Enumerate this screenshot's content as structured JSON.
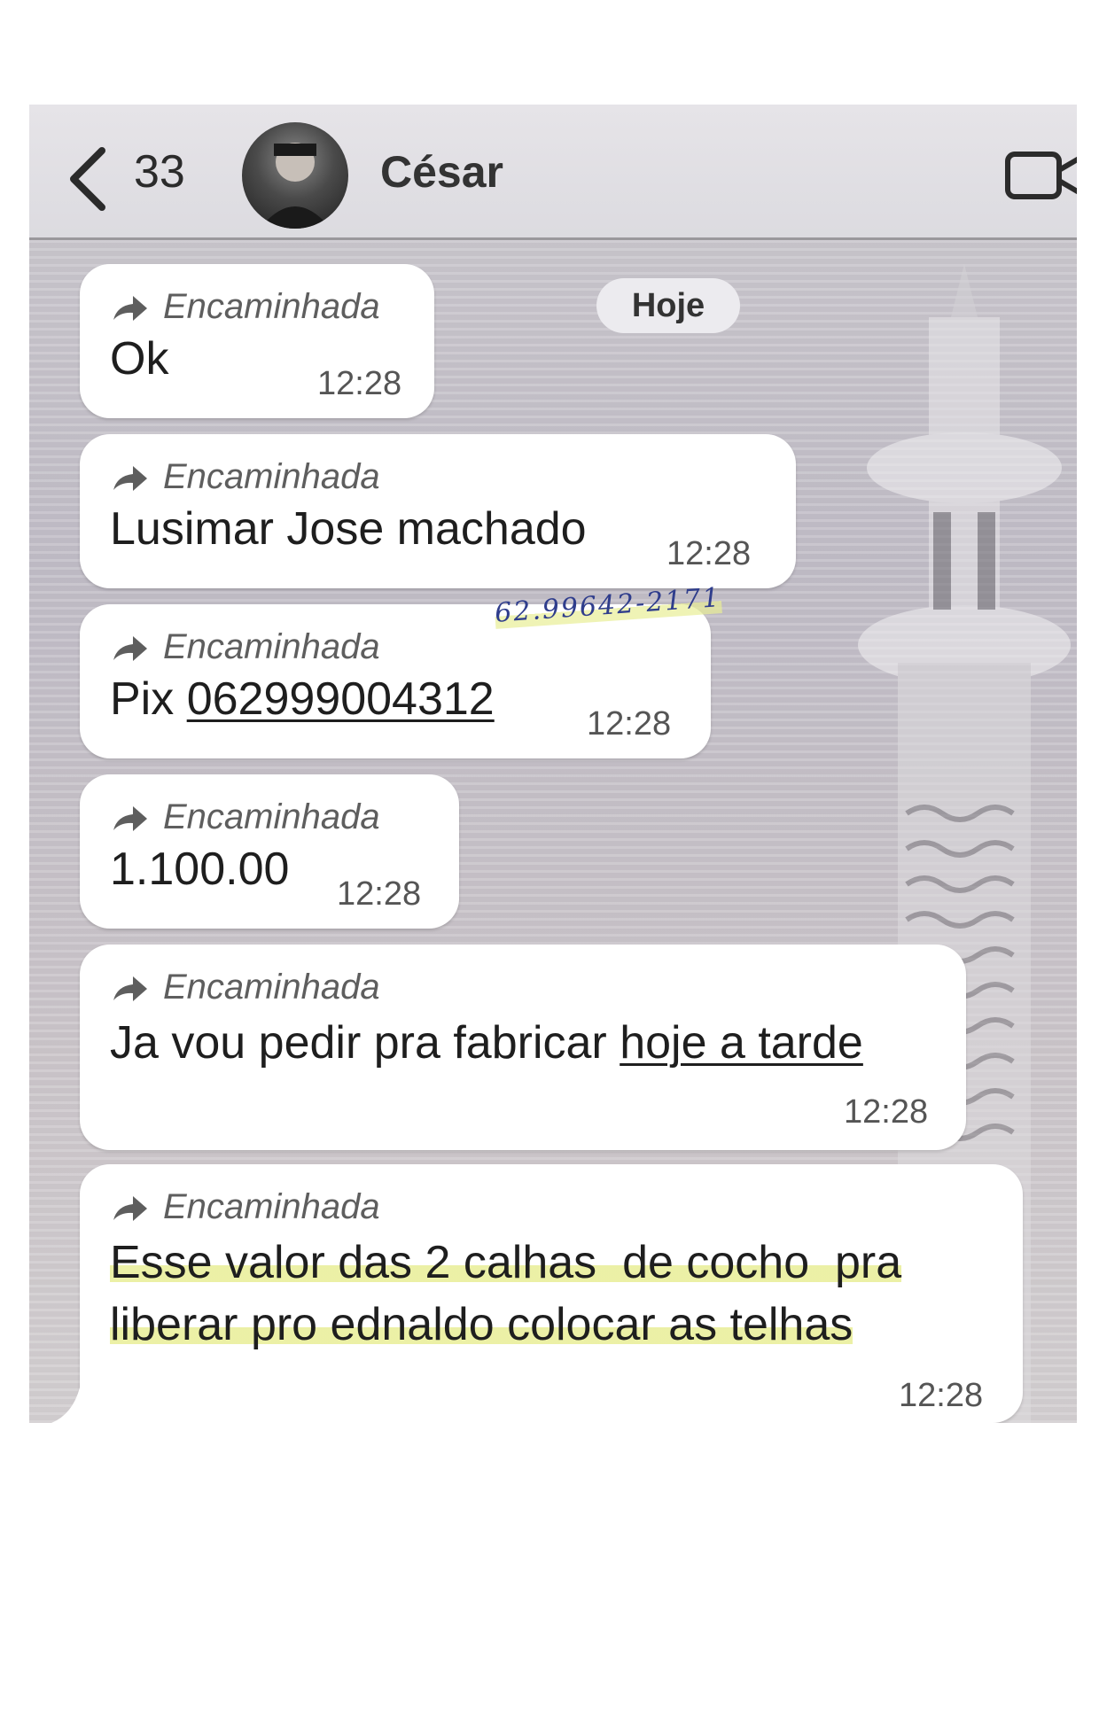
{
  "header": {
    "back_count": "33",
    "contact_name": "César",
    "icons": [
      "chevron-left-icon",
      "avatar",
      "video-call-icon"
    ]
  },
  "date_pill": "Hoje",
  "handwritten_note": "62.99642-2171",
  "messages": [
    {
      "forward_label": "Encaminhada",
      "text": "Ok",
      "time": "12:28"
    },
    {
      "forward_label": "Encaminhada",
      "text": "Lusimar Jose machado",
      "time": "12:28"
    },
    {
      "forward_label": "Encaminhada",
      "text_prefix": "Pix ",
      "link": "062999004312",
      "time": "12:28"
    },
    {
      "forward_label": "Encaminhada",
      "text": "1.100.00",
      "time": "12:28"
    },
    {
      "forward_label": "Encaminhada",
      "text_prefix": "Ja vou pedir pra fabricar ",
      "link": "hoje a tarde",
      "time": "12:28"
    },
    {
      "forward_label": "Encaminhada",
      "line1": "Esse valor das 2 calhas  de cocho  pra",
      "line2": "liberar pro ednaldo colocar as telhas",
      "time": "12:28"
    }
  ],
  "colors": {
    "bubble": "#ffffff",
    "highlight": "#e8ee96",
    "handwriting": "#2f3d8c"
  }
}
